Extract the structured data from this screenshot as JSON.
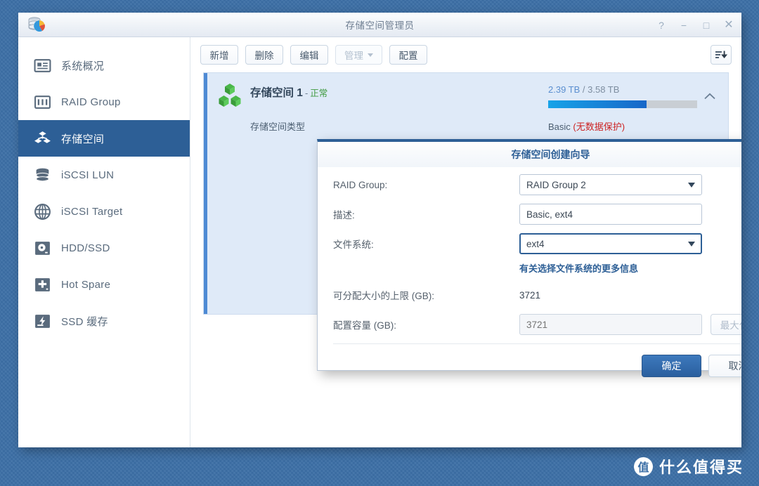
{
  "window": {
    "title": "存储空间管理员",
    "app_icon": "storage-manager-icon",
    "controls": {
      "help": "?",
      "minimize": "−",
      "maximize": "□",
      "close": "✕"
    }
  },
  "sidebar": {
    "items": [
      {
        "label": "系统概况",
        "icon": "overview-icon",
        "active": false
      },
      {
        "label": "RAID Group",
        "icon": "raid-group-icon",
        "active": false
      },
      {
        "label": "存储空间",
        "icon": "storage-space-icon",
        "active": true
      },
      {
        "label": "iSCSI LUN",
        "icon": "iscsi-lun-icon",
        "active": false
      },
      {
        "label": "iSCSI Target",
        "icon": "iscsi-target-icon",
        "active": false
      },
      {
        "label": "HDD/SSD",
        "icon": "hdd-ssd-icon",
        "active": false
      },
      {
        "label": "Hot Spare",
        "icon": "hot-spare-icon",
        "active": false
      },
      {
        "label": "SSD 缓存",
        "icon": "ssd-cache-icon",
        "active": false
      }
    ]
  },
  "toolbar": {
    "create_label": "新增",
    "delete_label": "删除",
    "edit_label": "编辑",
    "manage_label": "管理",
    "configure_label": "配置",
    "sort_icon": "sort-descending-icon"
  },
  "storage_panel": {
    "icon": "storage-volume-icon",
    "title": "存储空间 1",
    "separator": "-",
    "status": "正常",
    "capacity_text": "2.39 TB",
    "capacity_total": " / 3.58 TB",
    "used_percent": 66,
    "collapse_icon": "chevron-up-icon",
    "type_key": "存储空间类型",
    "type_value": "Basic ",
    "type_warning": "(无数据保护)"
  },
  "dialog": {
    "title": "存储空间创建向导",
    "fields": {
      "raid_group_label": "RAID Group:",
      "raid_group_value": "RAID Group 2",
      "description_label": "描述:",
      "description_value": "Basic, ext4",
      "filesystem_label": "文件系统:",
      "filesystem_value": "ext4",
      "filesystem_link": "有关选择文件系统的更多信息",
      "max_alloc_label": "可分配大小的上限 (GB):",
      "max_alloc_value": "3721",
      "capacity_label": "配置容量 (GB):",
      "capacity_placeholder": "3721",
      "capacity_value": "",
      "maximize_label": "最大化"
    },
    "buttons": {
      "ok": "确定",
      "cancel": "取消"
    }
  },
  "watermark": {
    "badge": "值",
    "text": "什么值得买"
  }
}
